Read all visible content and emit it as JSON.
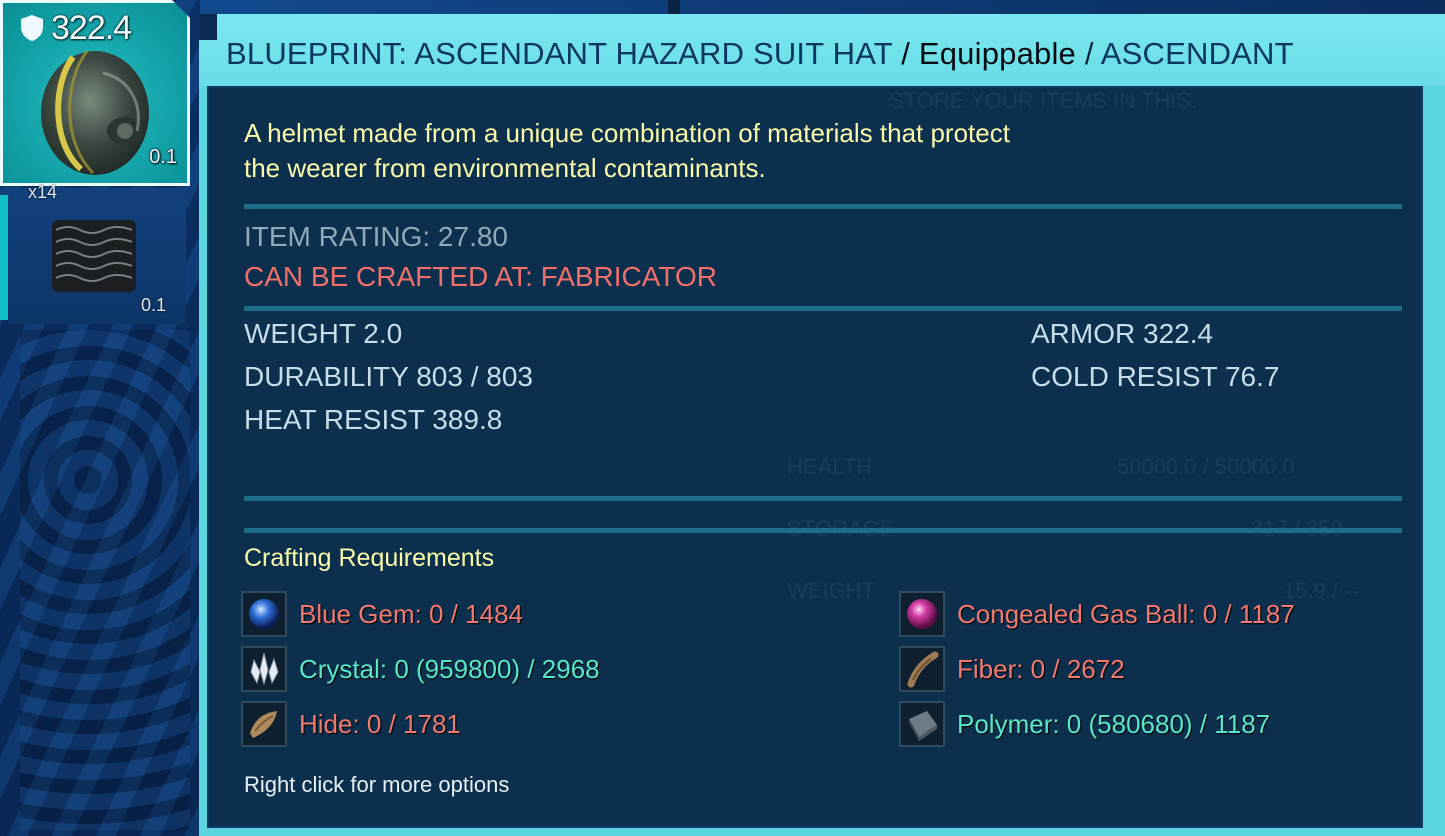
{
  "slot": {
    "rating": "322.4",
    "weight": "0.1",
    "second_quantity": "x14",
    "second_weight": "0.1"
  },
  "tooltip": {
    "title_main": "BLUEPRINT: ASCENDANT HAZARD SUIT HAT",
    "title_sep1": "/",
    "title_type": "Equippable",
    "title_sep2": "/",
    "title_quality": "ASCENDANT",
    "description_line1": "A helmet made from a unique combination of materials that protect",
    "description_line2": "the wearer from environmental contaminants.",
    "item_rating": "ITEM RATING: 27.80",
    "crafted_at": "CAN BE CRAFTED AT: FABRICATOR",
    "stats": {
      "weight": "WEIGHT 2.0",
      "durability": "DURABILITY 803 / 803",
      "heat_resist": "HEAT RESIST 389.8",
      "armor": "ARMOR 322.4",
      "cold_resist": "COLD RESIST 76.7"
    },
    "requirements_title": "Crafting Requirements",
    "requirements": [
      {
        "icon": "blue-gem-icon",
        "text": "Blue Gem: 0 / 1484",
        "status": "missing"
      },
      {
        "icon": "congealed-gas-ball-icon",
        "text": "Congealed Gas Ball: 0 / 1187",
        "status": "missing"
      },
      {
        "icon": "crystal-icon",
        "text": "Crystal: 0 (959800) / 2968",
        "status": "have"
      },
      {
        "icon": "fiber-icon",
        "text": "Fiber: 0 / 2672",
        "status": "missing"
      },
      {
        "icon": "hide-icon",
        "text": "Hide: 0 / 1781",
        "status": "missing"
      },
      {
        "icon": "polymer-icon",
        "text": "Polymer: 0 (580680) / 1187",
        "status": "have"
      }
    ],
    "hint": "Right click for more options"
  },
  "background": {
    "store_text": "STORE YOUR ITEMS IN THIS.",
    "health_label": "HEALTH",
    "health_value": "50000.0 / 50000.0",
    "storage_label": "STORAGE",
    "storage_value": "317 / 350",
    "weight_label": "WEIGHT",
    "weight_value": "15.9 / --"
  },
  "colors": {
    "header_bg": "#69dde6",
    "body_bg": "#08284a",
    "description": "#fafaa8",
    "missing": "#f07a70",
    "have": "#58e7c8",
    "crafted": "#ef6f6b"
  }
}
